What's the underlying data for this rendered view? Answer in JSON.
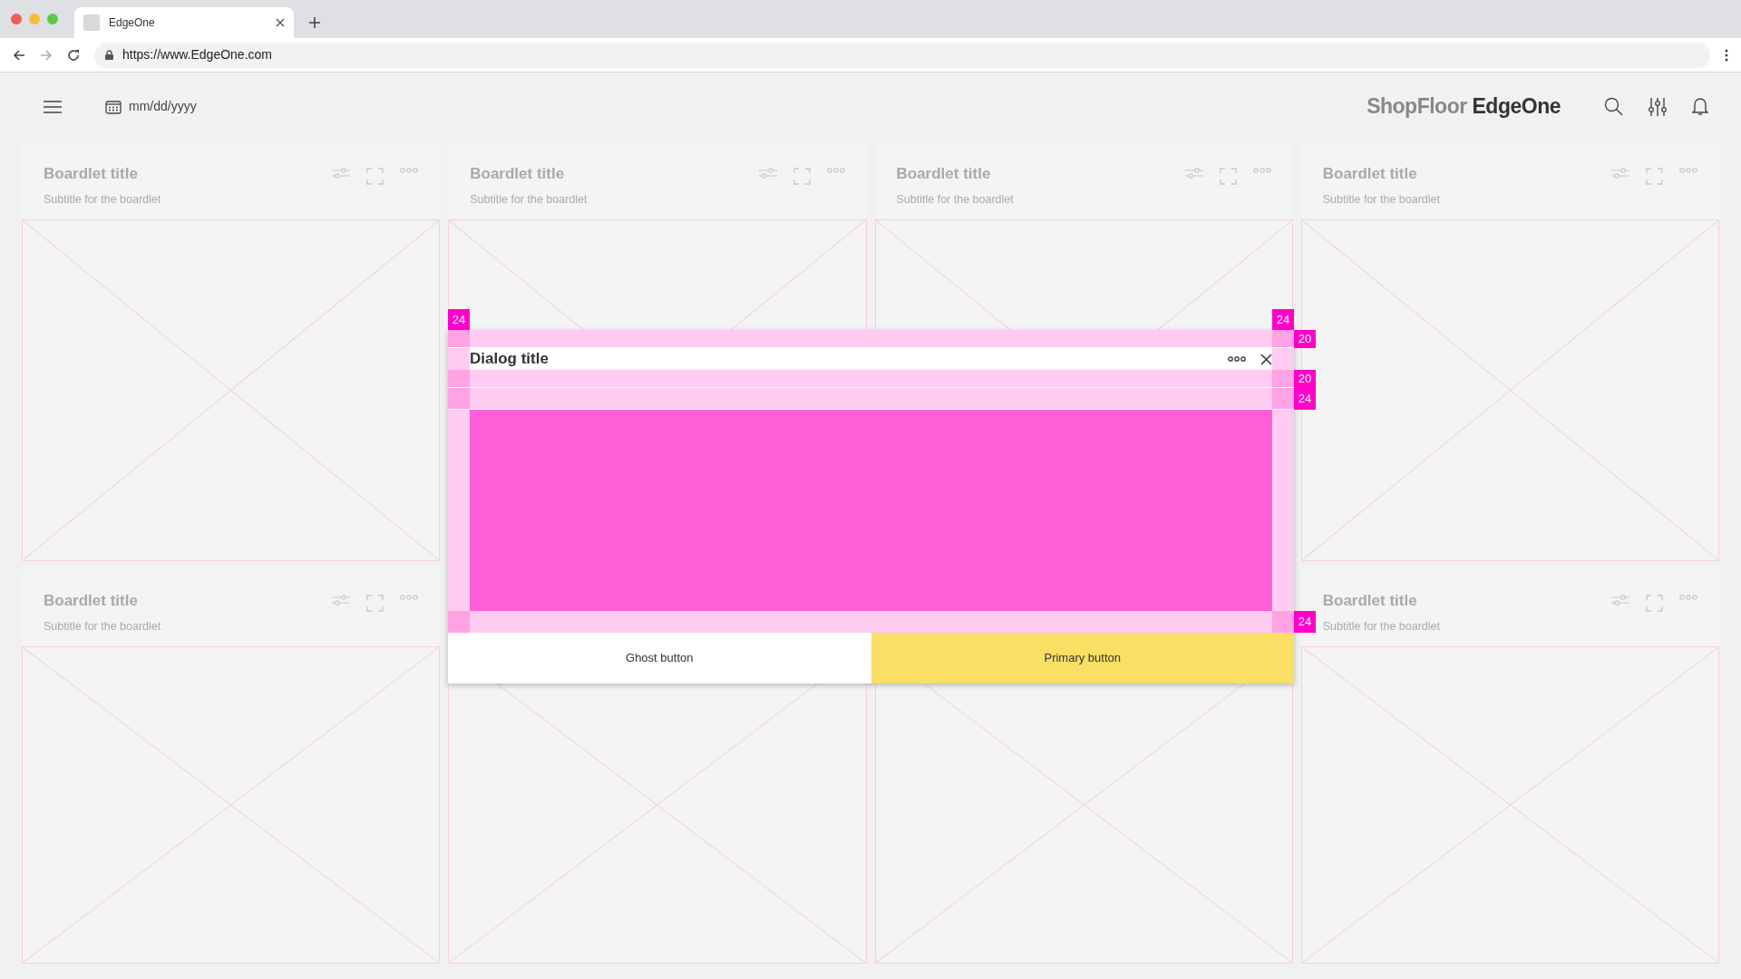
{
  "browser": {
    "tab_title": "EdgeOne",
    "url": "https://www.EdgeOne.com"
  },
  "header": {
    "date_placeholder": "mm/dd/yyyy",
    "brand_light": "ShopFloor",
    "brand_bold": "EdgeOne"
  },
  "boardlets": [
    {
      "title": "Boardlet title",
      "subtitle": "Subtitle for the boardlet"
    },
    {
      "title": "Boardlet title",
      "subtitle": "Subtitle for the boardlet"
    },
    {
      "title": "Boardlet title",
      "subtitle": "Subtitle for the boardlet"
    },
    {
      "title": "Boardlet title",
      "subtitle": "Subtitle for the boardlet"
    },
    {
      "title": "Boardlet title",
      "subtitle": "Subtitle for the boardlet"
    },
    {
      "title": "Boardlet title",
      "subtitle": "Subtitle for the boardlet"
    }
  ],
  "dialog": {
    "title": "Dialog title",
    "buttons": [
      {
        "label": "Ghost button",
        "kind": "ghost"
      },
      {
        "label": "Primary button",
        "kind": "primary"
      }
    ],
    "spacing_marks": [
      "24",
      "24",
      "20",
      "20",
      "24",
      "24"
    ]
  }
}
